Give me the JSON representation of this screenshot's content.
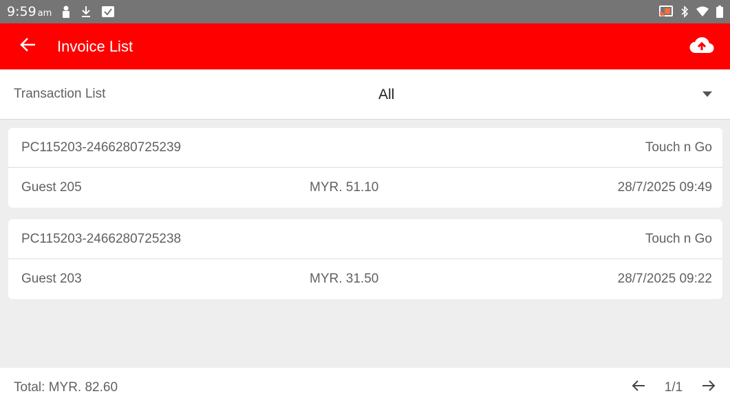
{
  "status_bar": {
    "time": "9:59",
    "ampm": "am",
    "left_icons": [
      "person-icon",
      "download-icon",
      "check-box-icon"
    ],
    "right_icons": [
      "cast-icon",
      "bluetooth-icon",
      "wifi-icon",
      "battery-icon"
    ]
  },
  "app_bar": {
    "title": "Invoice List",
    "back_icon": "arrow-left-icon",
    "action_icon": "cloud-upload-icon",
    "color": "#ff0000"
  },
  "filter": {
    "label": "Transaction List",
    "selected": "All"
  },
  "invoices": [
    {
      "invoice_no": "PC115203-2466280725239",
      "payment_method": "Touch n Go",
      "guest": "Guest 205",
      "amount": "MYR. 51.10",
      "datetime": "28/7/2025 09:49"
    },
    {
      "invoice_no": "PC115203-2466280725238",
      "payment_method": "Touch n Go",
      "guest": "Guest 203",
      "amount": "MYR. 31.50",
      "datetime": "28/7/2025 09:22"
    }
  ],
  "footer": {
    "total": "Total: MYR. 82.60",
    "page": "1/1"
  }
}
